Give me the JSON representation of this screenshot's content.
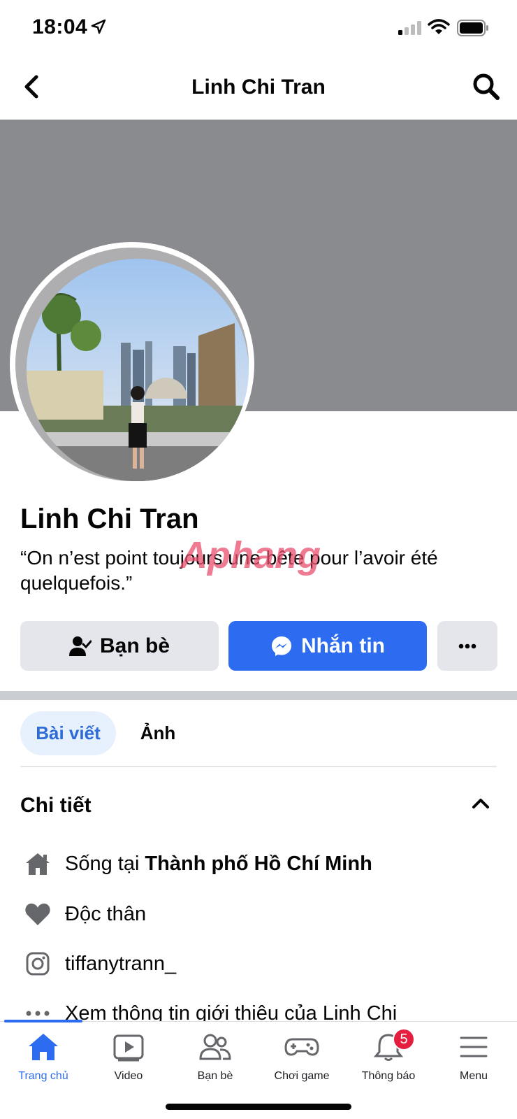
{
  "status_bar": {
    "time": "18:04"
  },
  "header": {
    "title": "Linh Chi Tran"
  },
  "profile": {
    "name": "Linh Chi Tran",
    "bio": "“On n’est point toujours une bête pour l’avoir été quelquefois.”"
  },
  "actions": {
    "friends_label": "Bạn bè",
    "message_label": "Nhắn tin"
  },
  "watermark": "Aphang",
  "tabs": [
    {
      "label": "Bài viết",
      "active": true
    },
    {
      "label": "Ảnh",
      "active": false
    }
  ],
  "details": {
    "heading": "Chi tiết",
    "lives_in_prefix": "Sống tại",
    "lives_in_city": "Thành phố Hồ Chí Minh",
    "relationship": "Độc thân",
    "instagram": "tiffanytrann_",
    "see_about": "Xem thông tin giới thiệu của Linh Chi"
  },
  "bottom_nav": [
    {
      "label": "Trang chủ",
      "icon": "home-icon",
      "active": true
    },
    {
      "label": "Video",
      "icon": "video-icon"
    },
    {
      "label": "Bạn bè",
      "icon": "friends-icon"
    },
    {
      "label": "Chơi game",
      "icon": "gaming-icon"
    },
    {
      "label": "Thông báo",
      "icon": "bell-icon",
      "badge": "5"
    },
    {
      "label": "Menu",
      "icon": "menu-icon"
    }
  ],
  "colors": {
    "accent": "#2d6cf0",
    "cover": "#8a8b8f",
    "badge": "#e41e3f",
    "button_gray": "#e4e6eb"
  }
}
